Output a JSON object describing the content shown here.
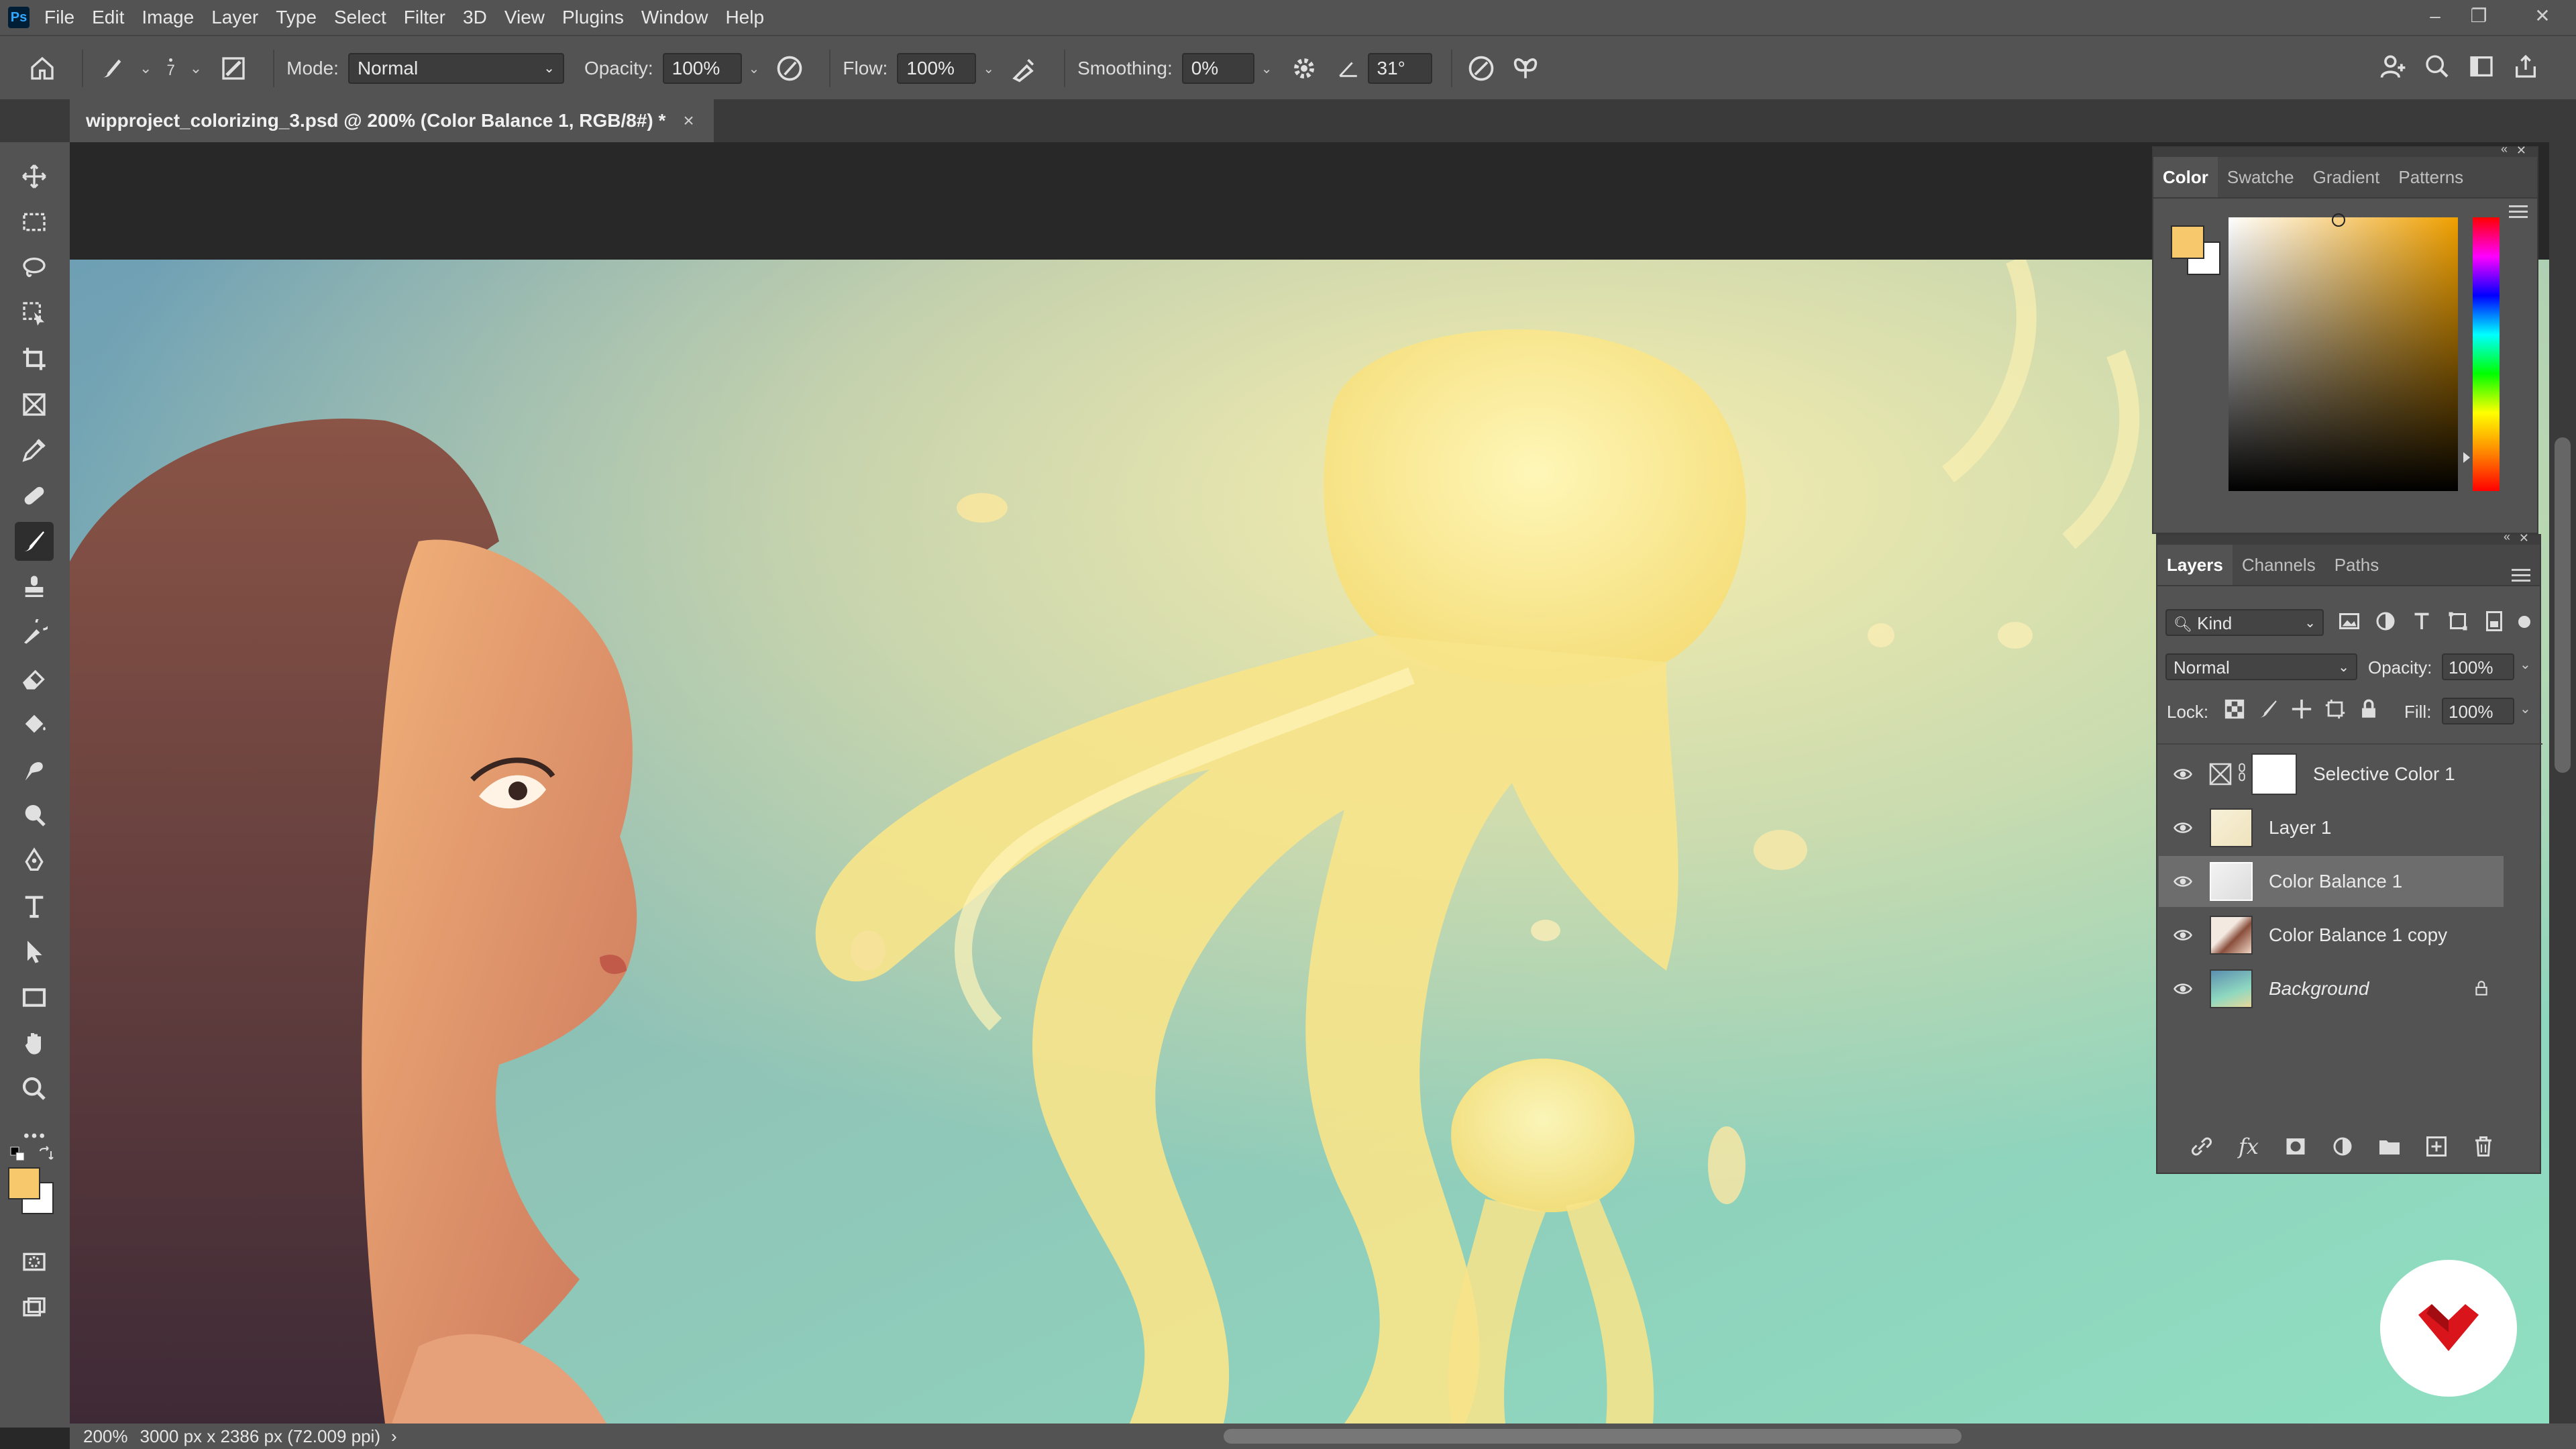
{
  "app": {
    "logo": "Ps"
  },
  "menu": [
    "File",
    "Edit",
    "Image",
    "Layer",
    "Type",
    "Select",
    "Filter",
    "3D",
    "View",
    "Plugins",
    "Window",
    "Help"
  ],
  "window_controls": {
    "minimize": "–",
    "restore": "❐",
    "close": "✕"
  },
  "options": {
    "brush_size": "7",
    "mode_label": "Mode:",
    "mode_value": "Normal",
    "opacity_label": "Opacity:",
    "opacity_value": "100%",
    "flow_label": "Flow:",
    "flow_value": "100%",
    "smoothing_label": "Smoothing:",
    "smoothing_value": "0%",
    "angle_value": "31°"
  },
  "document_tab": {
    "title": "wipproject_colorizing_3.psd @ 200% (Color Balance 1, RGB/8#) *",
    "close": "×"
  },
  "status": {
    "zoom": "200%",
    "doc_info": "3000 px x 2386 px (72.009 ppi)",
    "arrow": "›"
  },
  "color_panel": {
    "tabs": [
      "Color",
      "Swatche",
      "Gradient",
      "Patterns"
    ],
    "foreground": "#f8c86c",
    "background": "#ffffff"
  },
  "layers_panel": {
    "tabs": [
      "Layers",
      "Channels",
      "Paths"
    ],
    "filter_label": "Kind",
    "blend_mode": "Normal",
    "opacity_label": "Opacity:",
    "opacity_value": "100%",
    "lock_label": "Lock:",
    "fill_label": "Fill:",
    "fill_value": "100%",
    "layers": [
      {
        "name": "Selective Color 1",
        "selected": false
      },
      {
        "name": "Layer 1",
        "selected": false
      },
      {
        "name": "Color Balance 1",
        "selected": true
      },
      {
        "name": "Color Balance 1 copy",
        "selected": false
      },
      {
        "name": "Background",
        "selected": false,
        "locked": true
      }
    ]
  },
  "toolbar_colors": {
    "foreground": "#f8c86c",
    "background": "#ffffff"
  }
}
